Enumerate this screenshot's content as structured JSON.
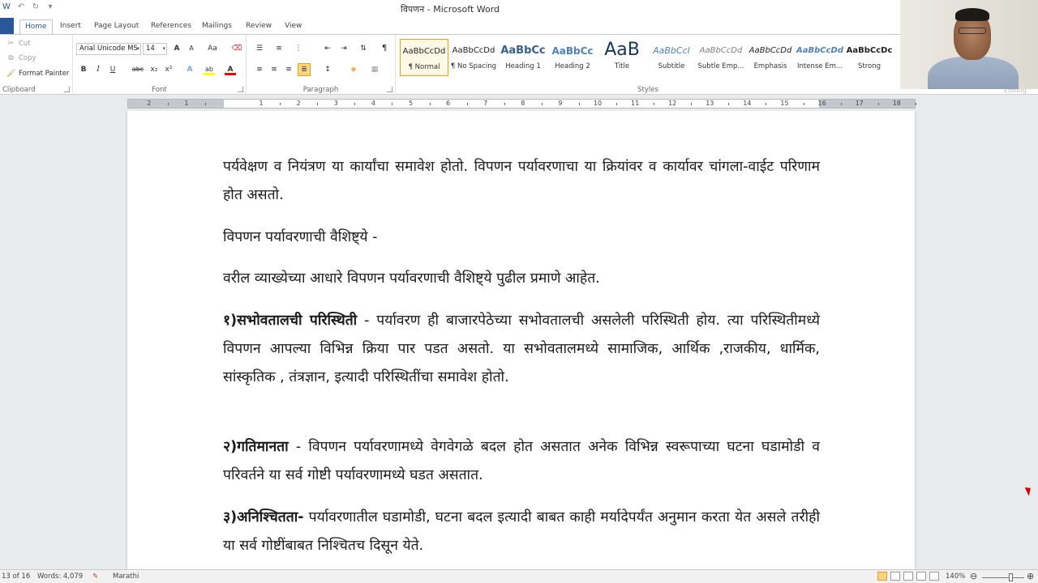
{
  "window": {
    "title": "विपणन - Microsoft Word",
    "qat_icons": [
      "word-logo",
      "undo-icon",
      "redo-icon",
      "customize-qat-icon"
    ]
  },
  "tabs": [
    {
      "label": "Home",
      "active": true
    },
    {
      "label": "Insert"
    },
    {
      "label": "Page Layout"
    },
    {
      "label": "References"
    },
    {
      "label": "Mailings"
    },
    {
      "label": "Review"
    },
    {
      "label": "View"
    }
  ],
  "clipboard": {
    "cut": "Cut",
    "copy": "Copy",
    "format_painter": "Format Painter",
    "label": "Clipboard"
  },
  "font": {
    "name": "Arial Unicode MS",
    "size": "14",
    "label": "Font",
    "grow": "A",
    "shrink": "A",
    "change_case": "Aa",
    "bold": "B",
    "italic": "I",
    "underline": "U",
    "strike": "abc",
    "subscript": "x₂",
    "superscript": "x²",
    "text_effects": "A",
    "highlight": "ab",
    "font_color": "A",
    "highlight_color": "#ffff00",
    "font_color_value": "#ff0000"
  },
  "paragraph": {
    "label": "Paragraph",
    "pilcrow": "¶"
  },
  "styles": {
    "label": "Styles",
    "items": [
      {
        "preview": "AaBbCcDd",
        "name": "¶ Normal",
        "selected": true
      },
      {
        "preview": "AaBbCcDd",
        "name": "¶ No Spacing"
      },
      {
        "preview": "AaBbCc",
        "name": "Heading 1"
      },
      {
        "preview": "AaBbCc",
        "name": "Heading 2"
      },
      {
        "preview": "AaB",
        "name": "Title"
      },
      {
        "preview": "AaBbCcI",
        "name": "Subtitle"
      },
      {
        "preview": "AaBbCcDd",
        "name": "Subtle Emp..."
      },
      {
        "preview": "AaBbCcDd",
        "name": "Emphasis"
      },
      {
        "preview": "AaBbCcDd",
        "name": "Intense Em..."
      },
      {
        "preview": "AaBbCcDc",
        "name": "Strong"
      }
    ]
  },
  "editing": {
    "label": "Editing"
  },
  "ruler": {
    "numbers": [
      "2",
      "1",
      "1",
      "2",
      "3",
      "4",
      "5",
      "6",
      "7",
      "8",
      "9",
      "10",
      "11",
      "12",
      "13",
      "14",
      "15",
      "16",
      "17",
      "18"
    ]
  },
  "document": {
    "p1": "पर्यवेक्षण व नियंत्रण या कार्यांचा समावेश होतो. विपणन पर्यावरणाचा या क्रियांवर व कार्यावर चांगला-वाईट परिणाम होत असतो.",
    "p2": "विपणन पर्यावरणाची वैशिष्ट्ये -",
    "p3": "वरील व्याख्येच्या आधारे विपणन पर्यावरणाची वैशिष्ट्ये पुढील प्रमाणे आहेत.",
    "p4_bold": "१)सभोवतालची परिस्थिती",
    "p4_rest": " - पर्यावरण ही बाजारपेठेच्या सभोवतालची असलेली परिस्थिती होय. त्या परिस्थितीमध्ये विपणन आपल्या विभिन्न क्रिया पार पडत असतो. या सभोवतालमध्ये सामाजिक, आर्थिक ,राजकीय, धार्मिक, सांस्कृतिक , तंत्रज्ञान, इत्यादी परिस्थितींचा समावेश होतो.",
    "p5_bold": "२)गतिमानता",
    "p5_rest": " - विपणन पर्यावरणामध्ये वेगवेगळे बदल होत असतात अनेक विभिन्न स्वरूपाच्या घटना घडामोडी व परिवर्तने या सर्व गोष्टी पर्यावरणामध्ये घडत असतात.",
    "p6_bold": "३)अनिश्चितता-",
    "p6_rest": " पर्यावरणातील घडामोडी, घटना बदल इत्यादी बाबत काही मर्यादेपर्यंत अनुमान करता येत असले तरीही या सर्व गोष्टींबाबत निश्चितच दिसून येते."
  },
  "status": {
    "page": "13 of 16",
    "words": "Words: 4,079",
    "language": "Marathi",
    "zoom": "140%",
    "zoom_percent": 140
  }
}
